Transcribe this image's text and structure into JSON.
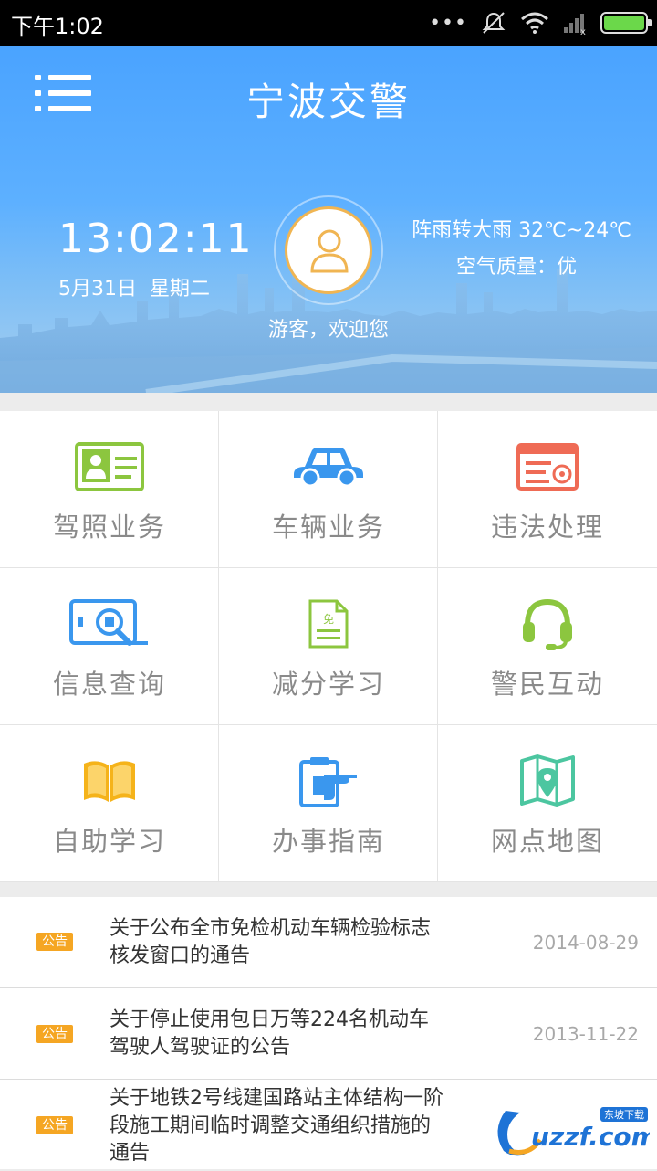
{
  "status_bar": {
    "time": "下午1:02"
  },
  "header": {
    "title": "宁波交警",
    "clock": "13:02:11",
    "date": "5月31日",
    "weekday": "星期二",
    "weather": "阵雨转大雨 32℃~24℃",
    "air_quality": "空气质量：优",
    "welcome": "游客，欢迎您"
  },
  "menu": {
    "items": [
      {
        "label": "驾照业务",
        "icon": "driver-license-icon"
      },
      {
        "label": "车辆业务",
        "icon": "car-icon"
      },
      {
        "label": "违法处理",
        "icon": "violation-certificate-icon"
      },
      {
        "label": "信息查询",
        "icon": "info-search-icon"
      },
      {
        "label": "减分学习",
        "icon": "document-icon"
      },
      {
        "label": "警民互动",
        "icon": "headset-icon"
      },
      {
        "label": "自助学习",
        "icon": "book-icon"
      },
      {
        "label": "办事指南",
        "icon": "clipboard-pointer-icon"
      },
      {
        "label": "网点地图",
        "icon": "map-pin-icon"
      }
    ]
  },
  "news": [
    {
      "badge": "公告",
      "title": "关于公布全市免检机动车辆检验标志核发窗口的通告",
      "date": "2014-08-29"
    },
    {
      "badge": "公告",
      "title": "关于停止使用包日万等224名机动车驾驶人驾驶证的公告",
      "date": "2013-11-22"
    },
    {
      "badge": "公告",
      "title": "关于地铁2号线建国路站主体结构一阶段施工期间临时调整交通组织措施的通告",
      "date": ""
    }
  ],
  "watermark": {
    "text": "uzzf.com",
    "tag": "东坡下载"
  },
  "colors": {
    "primary_blue": "#4aa3ff",
    "badge_orange": "#f5a623",
    "label_gray": "#8a8a8a",
    "green": "#8cc63f",
    "red": "#ef6b55"
  }
}
